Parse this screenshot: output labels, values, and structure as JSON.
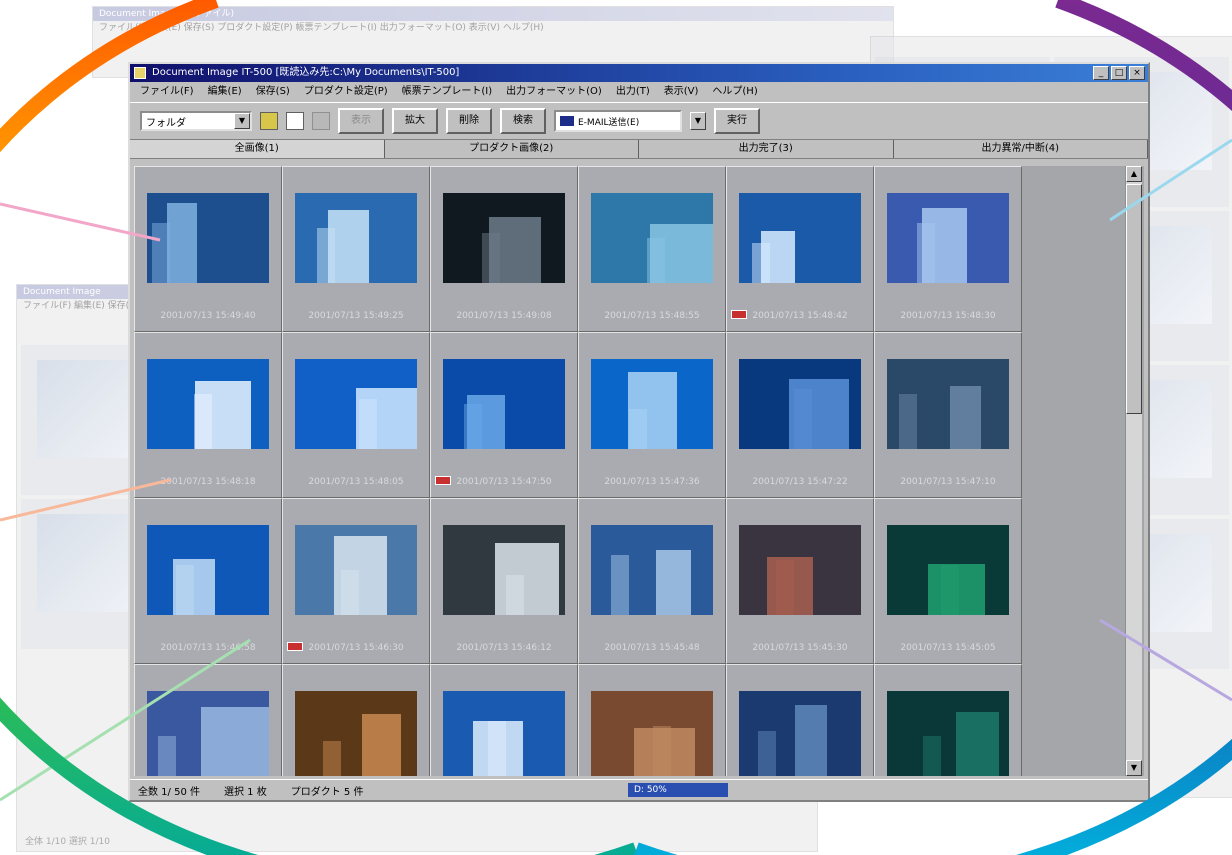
{
  "bg_windows": {
    "top": {
      "title": "Document Image ... (ファイル)",
      "menu": "ファイル(F)  編集(E)  保存(S)  プロダクト設定(P)  帳票テンプレート(I)  出力フォーマット(O)  表示(V)  ヘルプ(H)"
    },
    "left": {
      "title": "Document Image",
      "menu": "ファイル(F)  編集(E)  保存(S)",
      "status": "全体 1/10  選択 1/10"
    }
  },
  "window": {
    "title": "Document Image IT-500 [既読込み先:C:\\My Documents\\IT-500]",
    "menu": [
      "ファイル(F)",
      "編集(E)",
      "保存(S)",
      "プロダクト設定(P)",
      "帳票テンプレート(I)",
      "出力フォーマット(O)",
      "出力(T)",
      "表示(V)",
      "ヘルプ(H)"
    ],
    "toolbar": {
      "folder_combo": "フォルダ",
      "btn_show": "表示",
      "btn_zoom": "拡大",
      "btn_delete": "削除",
      "btn_search": "検索",
      "mail_combo": "E-MAIL送信(E)",
      "btn_exec": "実行"
    },
    "tabs": [
      "全画像(1)",
      "プロダクト画像(2)",
      "出力完了(3)",
      "出力異常/中断(4)"
    ],
    "thumbnails": [
      {
        "caption": "2001/07/13 15:49:40",
        "flag": false
      },
      {
        "caption": "2001/07/13 15:49:25",
        "flag": false
      },
      {
        "caption": "2001/07/13 15:49:08",
        "flag": false
      },
      {
        "caption": "2001/07/13 15:48:55",
        "flag": false
      },
      {
        "caption": "2001/07/13 15:48:42",
        "flag": true
      },
      {
        "caption": "2001/07/13 15:48:30",
        "flag": false
      },
      {
        "caption": "2001/07/13 15:48:18",
        "flag": false
      },
      {
        "caption": "2001/07/13 15:48:05",
        "flag": false
      },
      {
        "caption": "2001/07/13 15:47:50",
        "flag": true
      },
      {
        "caption": "2001/07/13 15:47:36",
        "flag": false
      },
      {
        "caption": "2001/07/13 15:47:22",
        "flag": false
      },
      {
        "caption": "2001/07/13 15:47:10",
        "flag": false
      },
      {
        "caption": "2001/07/13 15:46:58",
        "flag": false
      },
      {
        "caption": "2001/07/13 15:46:30",
        "flag": true
      },
      {
        "caption": "2001/07/13 15:46:12",
        "flag": false
      },
      {
        "caption": "2001/07/13 15:45:48",
        "flag": false
      },
      {
        "caption": "2001/07/13 15:45:30",
        "flag": false
      },
      {
        "caption": "2001/07/13 15:45:05",
        "flag": false
      },
      {
        "caption": "",
        "flag": false
      },
      {
        "caption": "",
        "flag": false
      },
      {
        "caption": "",
        "flag": false
      },
      {
        "caption": "",
        "flag": false
      },
      {
        "caption": "",
        "flag": false
      },
      {
        "caption": "",
        "flag": false
      }
    ],
    "status": {
      "total": "全数 1/ 50 件",
      "selected": "選択 1 枚",
      "product": "プロダクト 5 件",
      "drive": "D: 50%"
    }
  },
  "colors": {
    "title_gradient_start": "#10106a",
    "title_gradient_end": "#3a7fd8",
    "window_face": "#c0c0c0",
    "grid_bg": "#a4a6aa"
  }
}
